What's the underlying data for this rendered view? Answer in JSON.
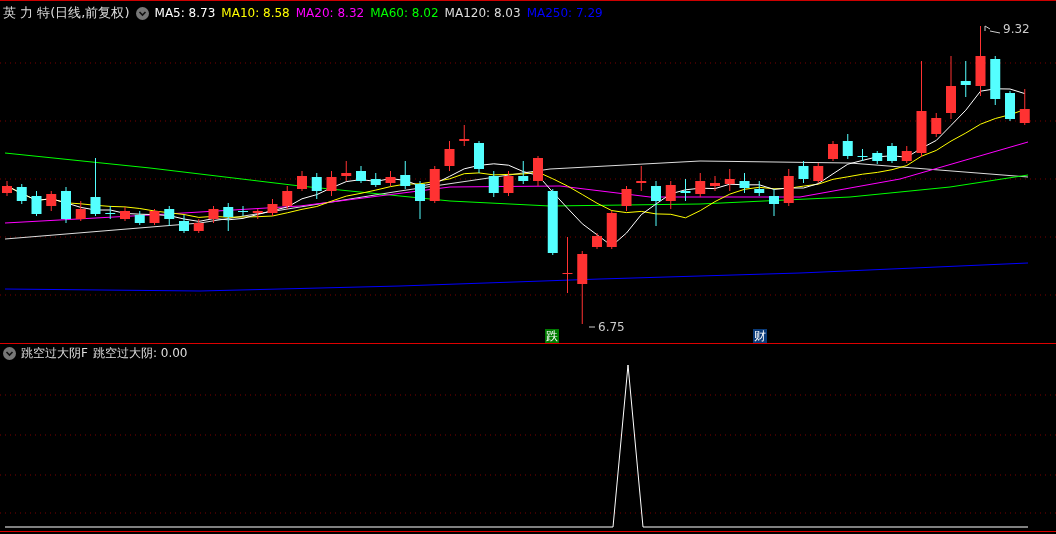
{
  "header": {
    "title": "英 力 特(日线,前复权)",
    "indicators": [
      {
        "label": "MA5: 8.73",
        "color": "#ffffff"
      },
      {
        "label": "MA10: 8.58",
        "color": "#ffff00"
      },
      {
        "label": "MA20: 8.32",
        "color": "#ff00ff"
      },
      {
        "label": "MA60: 8.02",
        "color": "#00ff00"
      },
      {
        "label": "MA120: 8.03",
        "color": "#dddddd"
      },
      {
        "label": "MA250: 7.29",
        "color": "#0000ff"
      }
    ]
  },
  "price_chart": {
    "high_label": "9.32",
    "low_label": "6.75",
    "markers": [
      {
        "text": "跌",
        "color": "#007a00"
      },
      {
        "text": "财",
        "color": "#0a3a78"
      }
    ]
  },
  "indicator_panel": {
    "title": "跳空过大阴F",
    "reading": "跳空过大阴: 0.00"
  }
}
